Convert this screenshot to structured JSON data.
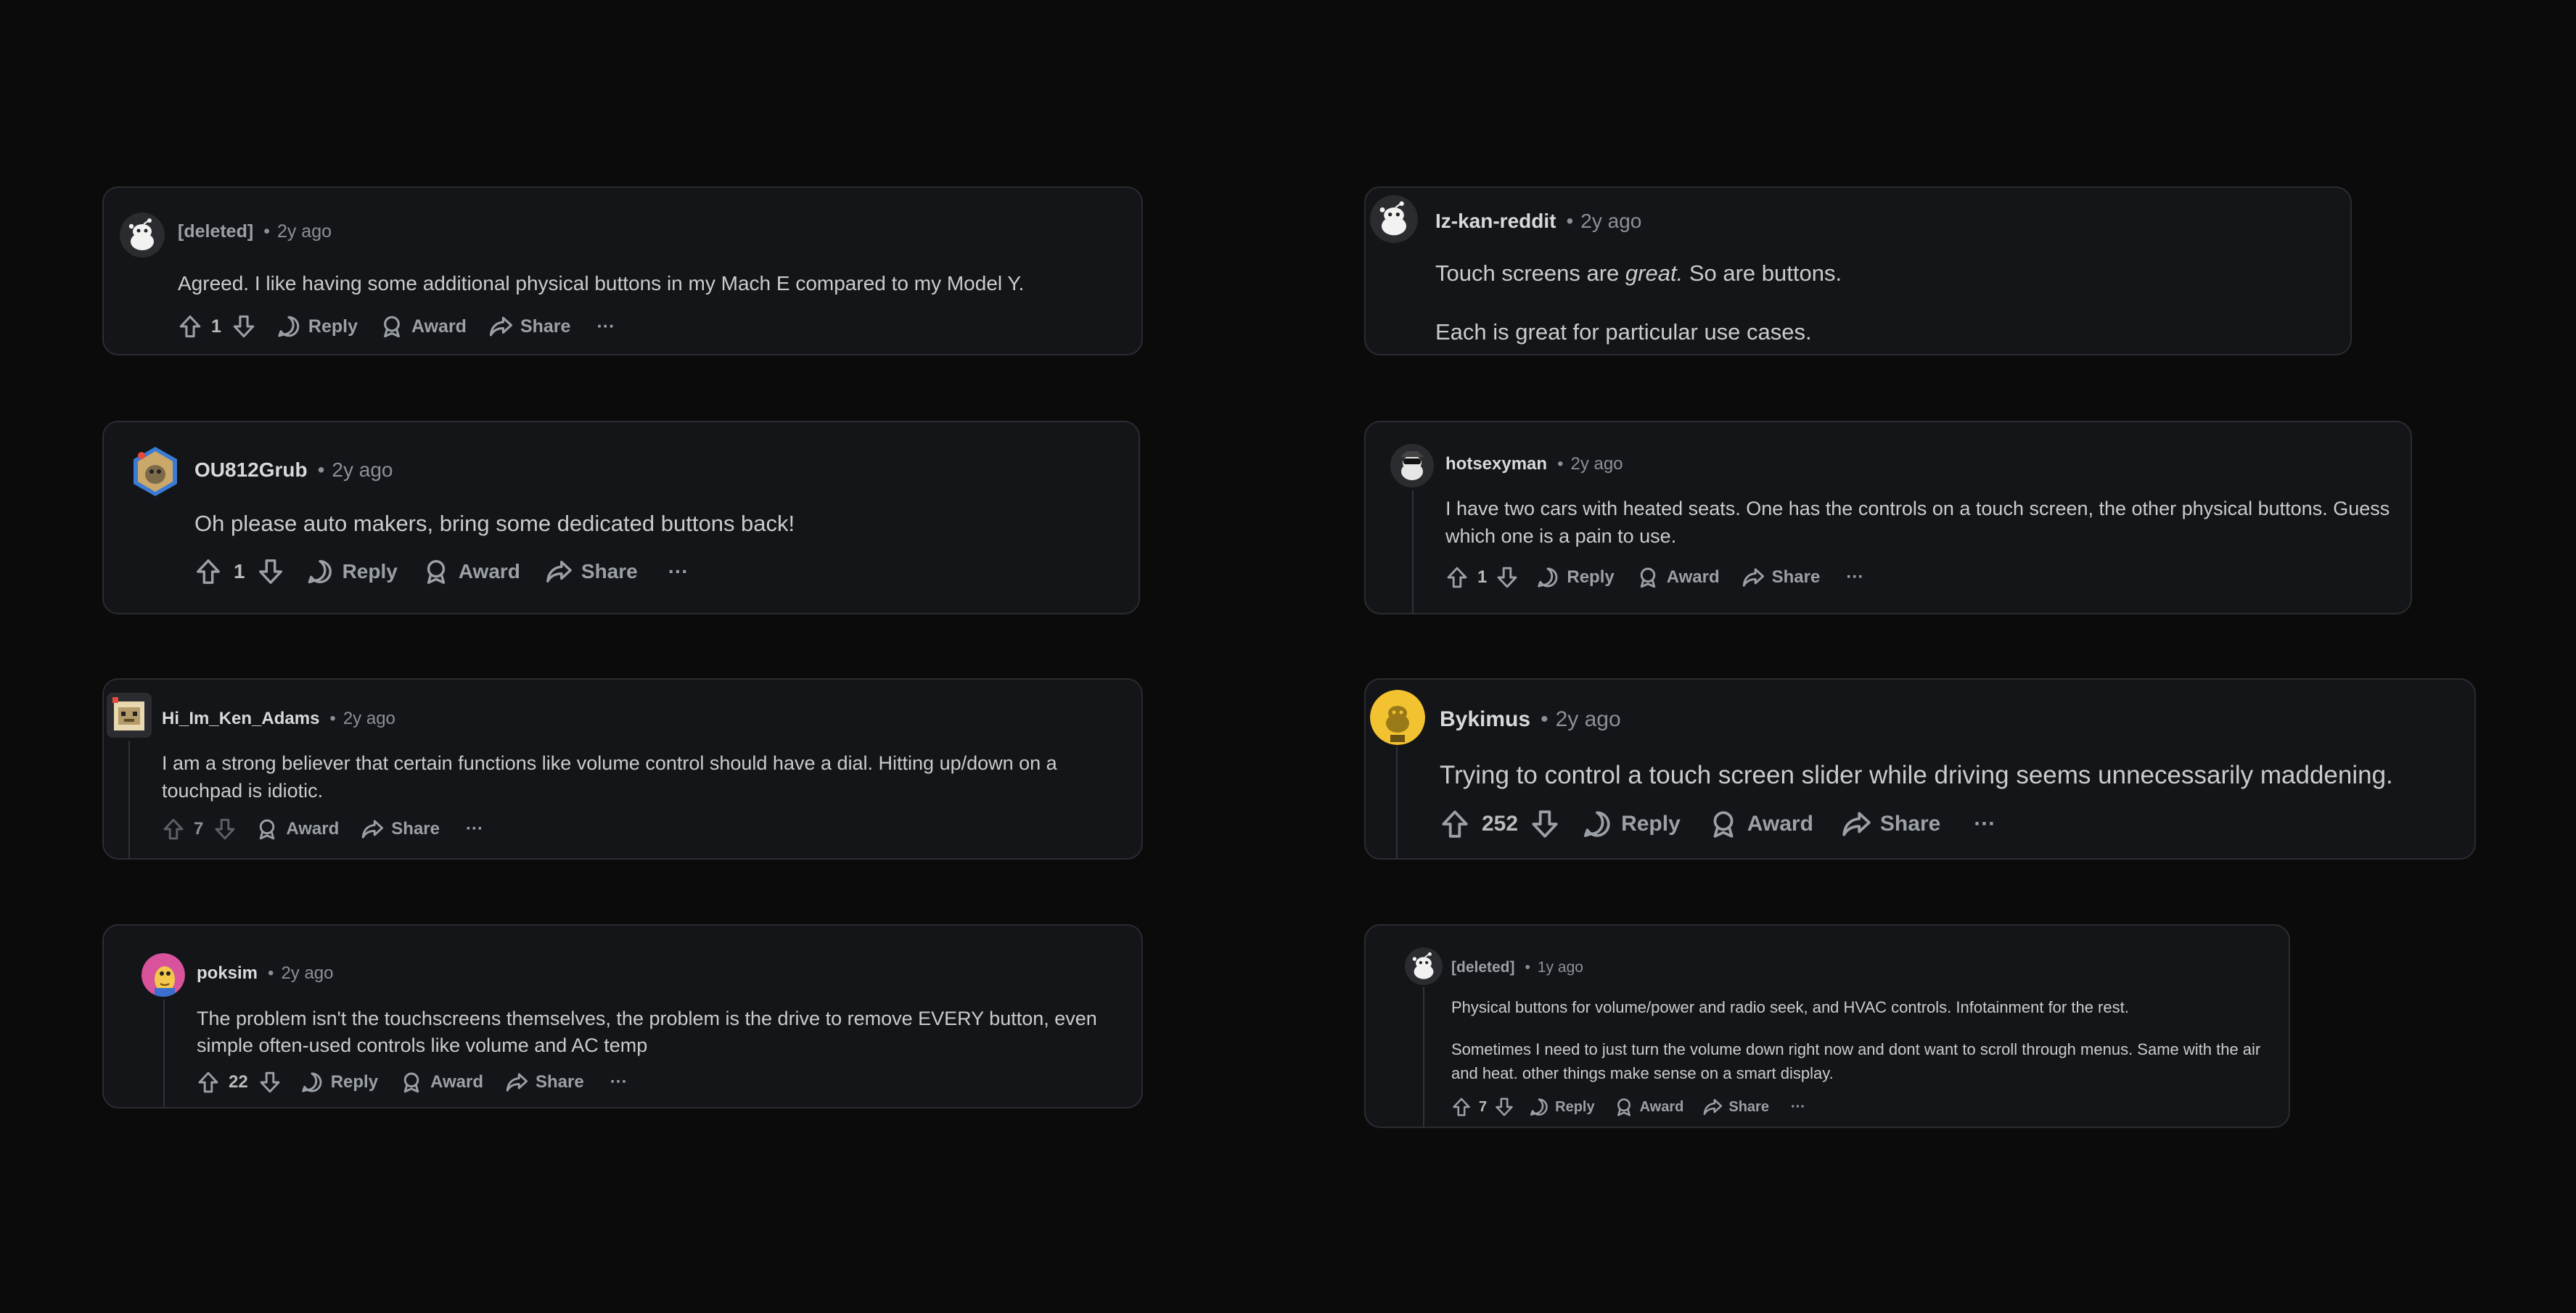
{
  "comments": [
    {
      "username": "[deleted]",
      "time": "2y ago",
      "text": [
        "Agreed. I like having some additional physical buttons in my Mach E compared to my Model Y."
      ],
      "votes": "1",
      "avatar": "snoo-white-icon"
    },
    {
      "username": "OU812Grub",
      "time": "2y ago",
      "text": [
        "Oh please auto makers, bring some dedicated buttons back!"
      ],
      "votes": "1",
      "avatar": "hexagon-avatar-icon"
    },
    {
      "username": "Hi_Im_Ken_Adams",
      "time": "2y ago",
      "text": [
        "I am a strong believer that certain functions like volume control should have a dial. Hitting up/down on a touchpad is idiotic."
      ],
      "votes": "7",
      "avatar": "pixel-avatar-icon"
    },
    {
      "username": "poksim",
      "time": "2y ago",
      "text": [
        "The problem isn't the touchscreens themselves, the problem is the drive to remove EVERY button, even simple often-used controls like volume and AC temp"
      ],
      "votes": "22",
      "avatar": "cartoon-avatar-icon"
    },
    {
      "username": "Iz-kan-reddit",
      "time": "2y ago",
      "text_parts": {
        "a": "Touch screens are ",
        "b": "great.",
        "c": " So are buttons."
      },
      "text": [
        "Each is great for particular use cases."
      ],
      "avatar": "snoo-white-icon"
    },
    {
      "username": "hotsexyman",
      "time": "2y ago",
      "text": [
        "I have two cars with heated seats. One has the controls on a touch screen, the other physical buttons. Guess which one is a pain to use."
      ],
      "votes": "1",
      "avatar": "snoo-dark-icon"
    },
    {
      "username": "Bykimus",
      "time": "2y ago",
      "text": [
        "Trying to control a touch screen slider while driving seems unnecessarily maddening."
      ],
      "votes": "252",
      "avatar": "yellow-snoo-icon"
    },
    {
      "username": "[deleted]",
      "time": "1y ago",
      "text": [
        "Physical buttons for volume/power and radio seek, and HVAC controls. Infotainment for the rest.",
        "Sometimes I need to just turn the volume down right now and dont want to scroll through menus. Same with the air and heat. other things make sense on a smart display."
      ],
      "votes": "7",
      "avatar": "snoo-white-icon"
    }
  ],
  "labels": {
    "dot": "•",
    "reply": "Reply",
    "award": "Award",
    "share": "Share",
    "more": "···"
  },
  "colors": {
    "background": "#0b0b0c",
    "card": "#141518",
    "border": "#2a2c30",
    "text": "#d7dadc",
    "muted": "#8b9096"
  }
}
